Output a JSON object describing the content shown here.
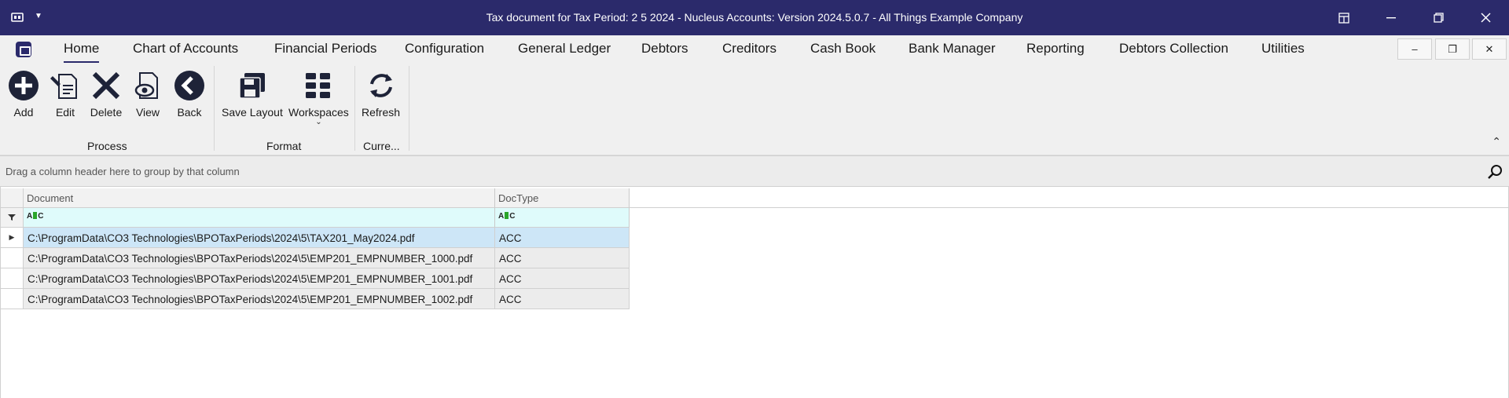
{
  "window": {
    "title": "Tax document for Tax Period: 2 5 2024 - Nucleus Accounts: Version 2024.5.0.7 - All Things Example Company",
    "minimize_glyph": "–",
    "maximize_glyph": "❐",
    "close_glyph": "✕"
  },
  "menu": {
    "items": [
      {
        "label": "Home"
      },
      {
        "label": "Chart of Accounts"
      },
      {
        "label": "Financial Periods"
      },
      {
        "label": "Configuration"
      },
      {
        "label": "General Ledger"
      },
      {
        "label": "Debtors"
      },
      {
        "label": "Creditors"
      },
      {
        "label": "Cash Book"
      },
      {
        "label": "Bank Manager"
      },
      {
        "label": "Reporting"
      },
      {
        "label": "Debtors Collection"
      },
      {
        "label": "Utilities"
      }
    ],
    "active": "Home",
    "mdi": {
      "minimize": "–",
      "restore": "❐",
      "close": "✕"
    }
  },
  "ribbon": {
    "groups": [
      {
        "label": "Process",
        "buttons": [
          {
            "label": "Add",
            "icon": "add-circle-icon"
          },
          {
            "label": "Edit",
            "icon": "edit-document-icon"
          },
          {
            "label": "Delete",
            "icon": "delete-x-icon"
          },
          {
            "label": "View",
            "icon": "view-document-icon"
          },
          {
            "label": "Back",
            "icon": "back-circle-icon"
          }
        ]
      },
      {
        "label": "Format",
        "buttons": [
          {
            "label": "Save Layout",
            "icon": "save-layout-icon"
          },
          {
            "label": "Workspaces",
            "icon": "workspaces-grid-icon"
          }
        ]
      },
      {
        "label": "Curre...",
        "buttons": [
          {
            "label": "Refresh",
            "icon": "refresh-icon"
          }
        ]
      }
    ],
    "collapse_glyph": "⌃"
  },
  "group_panel": {
    "hint": "Drag a column header here to group by that column"
  },
  "grid": {
    "columns": [
      "Document",
      "DocType"
    ],
    "rows": [
      {
        "document": "C:\\ProgramData\\CO3 Technologies\\BPOTaxPeriods\\2024\\5\\TAX201_May2024.pdf",
        "doctype": "ACC",
        "selected": true
      },
      {
        "document": "C:\\ProgramData\\CO3 Technologies\\BPOTaxPeriods\\2024\\5\\EMP201_EMPNUMBER_1000.pdf",
        "doctype": "ACC"
      },
      {
        "document": "C:\\ProgramData\\CO3 Technologies\\BPOTaxPeriods\\2024\\5\\EMP201_EMPNUMBER_1001.pdf",
        "doctype": "ACC"
      },
      {
        "document": "C:\\ProgramData\\CO3 Technologies\\BPOTaxPeriods\\2024\\5\\EMP201_EMPNUMBER_1002.pdf",
        "doctype": "ACC"
      }
    ],
    "colors": {
      "selected_row": "#cde6f7",
      "normal_row": "#ececec",
      "filter_row": "#dffbfb"
    }
  },
  "theme": {
    "titlebar": "#2b2a6b",
    "ribbon_bg": "#f0f0f0"
  }
}
